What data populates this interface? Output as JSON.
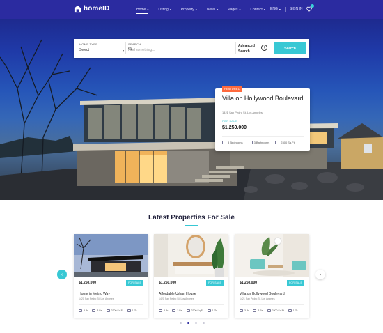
{
  "brand": {
    "name": "homeID"
  },
  "nav": [
    {
      "label": "Home",
      "chevron": true,
      "active": true
    },
    {
      "label": "Listing",
      "chevron": true
    },
    {
      "label": "Property",
      "chevron": true
    },
    {
      "label": "News",
      "chevron": true
    },
    {
      "label": "Pages",
      "chevron": true
    },
    {
      "label": "Contact",
      "chevron": true
    }
  ],
  "util": {
    "language": "ENG",
    "signin": "SIGN IN",
    "wishlist_count": ""
  },
  "search": {
    "type_label": "HOME TYPE",
    "type_value": "Select",
    "query_label": "SEARCH",
    "query_placeholder": "Find something...",
    "advanced_label": "Advanced Search",
    "button": "Search"
  },
  "featured": {
    "tag": "FEATURED",
    "title": "Villa on Hollywood Boulevard",
    "address": "1421 San Pedro St, Los Angeles",
    "status": "FOR SALE",
    "price": "$1.250.000",
    "bedrooms": "3 Bedrooms",
    "bathrooms": "3 Bathrooms",
    "area": "2300 Sq.Ft"
  },
  "listings": {
    "title": "Latest Properties For Sale",
    "cards": [
      {
        "price": "$1.250.000",
        "badge": "FOR SALE",
        "title": "Home in Metric Way",
        "address": "1421 San Pedro St, Los Angeles",
        "beds": "3 Br",
        "baths": "3 Ba",
        "area": "2300 Sq.Ft",
        "garage": "1 Gr"
      },
      {
        "price": "$1.250.000",
        "badge": "FOR SALE",
        "title": "Affordable Urban House",
        "address": "1421 San Pedro St, Los Angeles",
        "beds": "3 Br",
        "baths": "3 Ba",
        "area": "2300 Sq.Ft",
        "garage": "1 Gr"
      },
      {
        "price": "$1.250.000",
        "badge": "FOR SALE",
        "title": "Villa on Hollywood Boulevard",
        "address": "1421 San Pedro St, Los Angeles",
        "beds": "3 Br",
        "baths": "3 Ba",
        "area": "2300 Sq.Ft",
        "garage": "1 Gr"
      }
    ],
    "carousel": {
      "pages": 4,
      "active_page": 2
    }
  },
  "colors": {
    "navy": "#2b2ba0",
    "accent": "#38c8d4",
    "tag": "#ff6a3d"
  }
}
